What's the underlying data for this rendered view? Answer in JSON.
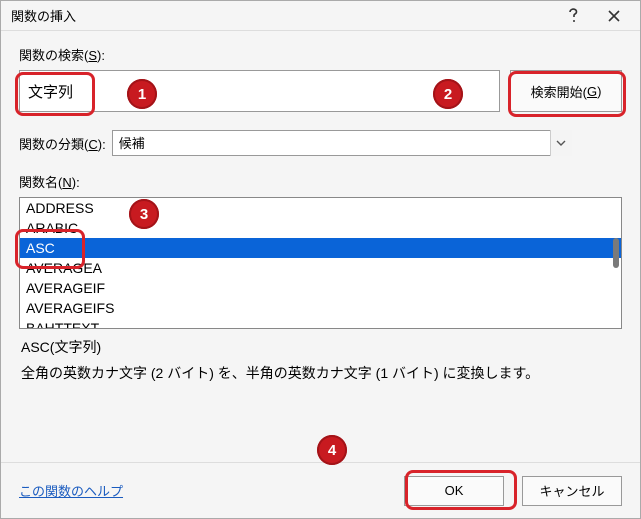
{
  "title": "関数の挿入",
  "search": {
    "label_pre": "関数の検索(",
    "label_key": "S",
    "label_post": "):",
    "value": "文字列",
    "go_pre": "検索開始(",
    "go_key": "G",
    "go_post": ")"
  },
  "category": {
    "label_pre": "関数の分類(",
    "label_key": "C",
    "label_post": "):",
    "selected": "候補"
  },
  "functions": {
    "label_pre": "関数名(",
    "label_key": "N",
    "label_post": "):",
    "items": [
      "ADDRESS",
      "ARABIC",
      "ASC",
      "AVERAGEA",
      "AVERAGEIF",
      "AVERAGEIFS",
      "BAHTTEXT"
    ],
    "selected_index": 2
  },
  "description": {
    "title": "ASC(文字列)",
    "body": "全角の英数カナ文字 (2 バイト) を、半角の英数カナ文字 (1 バイト) に変換します。"
  },
  "footer": {
    "help": "この関数のヘルプ",
    "ok": "OK",
    "cancel": "キャンセル"
  },
  "badges": {
    "b1": "1",
    "b2": "2",
    "b3": "3",
    "b4": "4"
  }
}
